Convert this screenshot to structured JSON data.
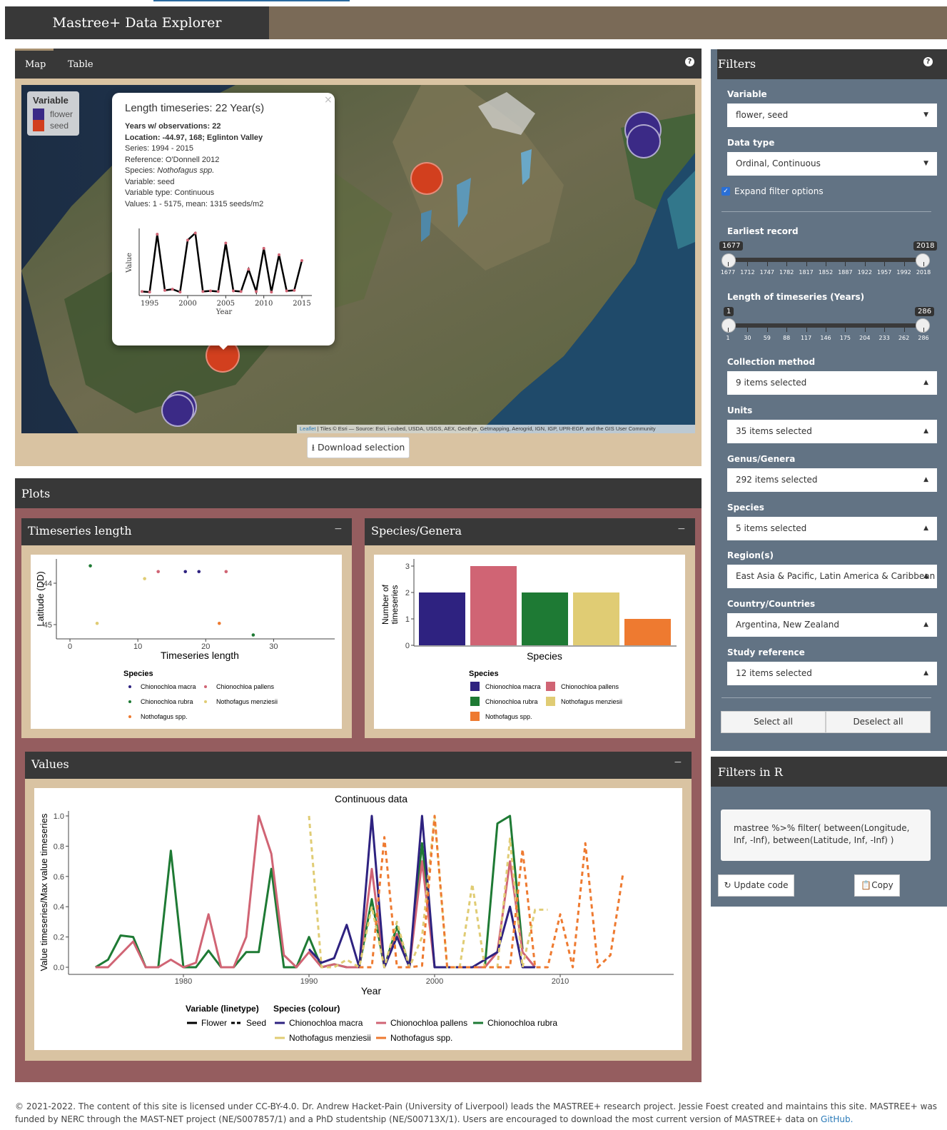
{
  "app": {
    "title": "Mastree+ Data Explorer"
  },
  "tabs": [
    "Map",
    "Table"
  ],
  "map": {
    "legend_title": "Variable",
    "legend_items": [
      {
        "label": "flower",
        "color": "#3b2a86"
      },
      {
        "label": "seed",
        "color": "#d23f1e"
      }
    ],
    "attribution_link": "Leaflet",
    "attribution_text": " | Tiles © Esri — Source: Esri, i-cubed, USDA, USGS, AEX, GeoEye, Getmapping, Aerogrid, IGN, IGP, UPR-EGP, and the GIS User Community",
    "download_label": "Download selection"
  },
  "popup": {
    "title": "Length timeseries: 22 Year(s)",
    "years": "Years w/ observations: 22",
    "location": "Location: -44.97, 168; Eglinton Valley",
    "series": "Series: 1994 - 2015",
    "reference": "Reference: O'Donnell 2012",
    "species_prefix": "Species: ",
    "species_name": "Nothofagus spp.",
    "variable": "Variable: seed",
    "variable_type": "Variable type: Continuous",
    "values": "Values: 1 - 5175, mean: 1315 seeds/m2",
    "close": "×",
    "chart_ylabel": "Value",
    "chart_xlabel": "Year",
    "chart_xticks": [
      "1995",
      "2000",
      "2005",
      "2010",
      "2015"
    ]
  },
  "filters": {
    "title": "Filters",
    "variable_label": "Variable",
    "variable_value": "flower, seed",
    "datatype_label": "Data type",
    "datatype_value": "Ordinal, Continuous",
    "expand_label": "Expand filter options",
    "earliest_label": "Earliest record",
    "earliest_min": "1677",
    "earliest_max": "2018",
    "earliest_ticks": [
      "1677",
      "1712",
      "1747",
      "1782",
      "1817",
      "1852",
      "1887",
      "1922",
      "1957",
      "1992",
      "2018"
    ],
    "length_label": "Length of timeseries (Years)",
    "length_min": "1",
    "length_max": "286",
    "length_ticks": [
      "1",
      "30",
      "59",
      "88",
      "117",
      "146",
      "175",
      "204",
      "233",
      "262",
      "286"
    ],
    "collection_label": "Collection method",
    "collection_value": "9 items selected",
    "units_label": "Units",
    "units_value": "35 items selected",
    "genus_label": "Genus/Genera",
    "genus_value": "292 items selected",
    "species_label": "Species",
    "species_value": "5 items selected",
    "region_label": "Region(s)",
    "region_value": "East Asia & Pacific, Latin America & Caribbean",
    "country_label": "Country/Countries",
    "country_value": "Argentina, New Zealand",
    "study_label": "Study reference",
    "study_value": "12 items selected",
    "select_all": "Select all",
    "deselect_all": "Deselect all"
  },
  "filters_r": {
    "title": "Filters in R",
    "code": "mastree %>% filter( between(Longitude, Inf, -Inf), between(Latitude, Inf, -Inf) )",
    "update_label": "Update code",
    "copy_label": "Copy"
  },
  "plots": {
    "title": "Plots",
    "ts_title": "Timeseries length",
    "sg_title": "Species/Genera",
    "values_title": "Values",
    "collapse": "−"
  },
  "species_colors": {
    "Chionochloa macra": "#2e2280",
    "Chionochloa pallens": "#d06474",
    "Chionochloa rubra": "#1e7a34",
    "Nothofagus menziesii": "#e0cc74",
    "Nothofagus spp.": "#ee7a30"
  },
  "chart_data": [
    {
      "type": "line",
      "title": "Length timeseries: 22 Year(s)",
      "xlabel": "Year",
      "ylabel": "Value",
      "xlim": [
        1994,
        2015
      ],
      "x": [
        1994,
        1995,
        1996,
        1997,
        1998,
        1999,
        2000,
        2001,
        2002,
        2003,
        2004,
        2005,
        2006,
        2007,
        2008,
        2009,
        2010,
        2011,
        2012,
        2013,
        2014,
        2015
      ],
      "series": [
        {
          "values": [
            20,
            10,
            1000,
            40,
            60,
            10,
            900,
            1020,
            20,
            30,
            20,
            850,
            30,
            20,
            400,
            20,
            760,
            10,
            650,
            30,
            40,
            550
          ]
        }
      ]
    },
    {
      "type": "scatter",
      "xlabel": "Timeseries length",
      "ylabel": "Latitude (DD)",
      "xlim": [
        -2,
        39
      ],
      "yticks": [
        -44,
        -45
      ],
      "xticks": [
        0,
        10,
        20,
        30
      ],
      "legend_title": "Species",
      "points": [
        {
          "species": "Chionochloa rubra",
          "x": 3,
          "y": -43.58
        },
        {
          "species": "Nothofagus menziesii",
          "x": 4,
          "y": -44.97
        },
        {
          "species": "Nothofagus menziesii",
          "x": 11,
          "y": -43.89
        },
        {
          "species": "Chionochloa pallens",
          "x": 13,
          "y": -43.72
        },
        {
          "species": "Chionochloa macra",
          "x": 17,
          "y": -43.72
        },
        {
          "species": "Chionochloa macra",
          "x": 19,
          "y": -43.72
        },
        {
          "species": "Nothofagus spp.",
          "x": 22,
          "y": -44.97
        },
        {
          "species": "Chionochloa pallens",
          "x": 23,
          "y": -43.72
        },
        {
          "species": "Chionochloa rubra",
          "x": 27,
          "y": -45.25
        }
      ]
    },
    {
      "type": "bar",
      "xlabel": "Species",
      "ylabel": "Number of timeseries",
      "ylim": [
        0,
        3
      ],
      "yticks": [
        0,
        1,
        2,
        3
      ],
      "legend_title": "Species",
      "categories": [
        "Chionochloa macra",
        "Chionochloa pallens",
        "Chionochloa rubra",
        "Nothofagus menziesii",
        "Nothofagus spp."
      ],
      "values": [
        2,
        3,
        2,
        2,
        1
      ]
    },
    {
      "type": "line",
      "title": "Continuous data",
      "xlabel": "Year",
      "ylabel": "Value timeseries/Max value timeseries",
      "xlim": [
        1972,
        2020
      ],
      "ylim": [
        0,
        1
      ],
      "xticks": [
        1980,
        1990,
        2000,
        2010
      ],
      "yticks": [
        "0.0",
        "0.2",
        "0.4",
        "0.6",
        "0.8",
        "1.0"
      ],
      "legend_linetype_title": "Variable (linetype)",
      "legend_linetypes": [
        "Flower",
        "Seed"
      ],
      "legend_colour_title": "Species (colour)",
      "series": [
        {
          "species": "Chionochloa rubra",
          "linetype": "Flower",
          "x": [
            1973,
            1974,
            1975,
            1976,
            1977,
            1978,
            1979,
            1980,
            1981,
            1982,
            1983,
            1984,
            1985,
            1986,
            1987,
            1988,
            1989,
            1990,
            1991,
            1992,
            1993,
            1994,
            1995,
            1996,
            1997,
            1998,
            1999,
            2000,
            2001,
            2002,
            2003,
            2004,
            2005,
            2006,
            2007
          ],
          "y": [
            0.0,
            0.05,
            0.21,
            0.2,
            0.0,
            0.0,
            0.77,
            0.0,
            0.0,
            0.11,
            0.0,
            0.0,
            0.1,
            0.1,
            0.65,
            0.0,
            0.0,
            0.2,
            0.0,
            0.02,
            0.0,
            0.0,
            0.45,
            0.0,
            0.27,
            0.0,
            0.82,
            0.0,
            0.0,
            0.0,
            0.0,
            0.0,
            0.95,
            1.0,
            0.12
          ]
        },
        {
          "species": "Chionochloa pallens",
          "linetype": "Flower",
          "x": [
            1973,
            1974,
            1976,
            1977,
            1978,
            1979,
            1980,
            1981,
            1982,
            1983,
            1984,
            1985,
            1986,
            1987,
            1988,
            1989,
            1990,
            1991,
            1992,
            1993,
            1994,
            1995,
            1996,
            1997,
            1998,
            1999,
            2000,
            2001,
            2002,
            2003,
            2004,
            2005,
            2006,
            2007,
            2008
          ],
          "y": [
            0.0,
            0.0,
            0.17,
            0.0,
            0.0,
            0.05,
            0.0,
            0.03,
            0.35,
            0.0,
            0.0,
            0.2,
            1.0,
            0.75,
            0.08,
            0.0,
            0.1,
            0.0,
            0.02,
            0.0,
            0.0,
            0.65,
            0.0,
            0.22,
            0.0,
            0.7,
            0.0,
            0.0,
            0.0,
            0.0,
            0.0,
            0.1,
            0.7,
            0.1,
            0.0
          ]
        },
        {
          "species": "Chionochloa macra",
          "linetype": "Flower",
          "x": [
            1990,
            1991,
            1992,
            1993,
            1994,
            1995,
            1996,
            1997,
            1998,
            1999,
            2000,
            2001,
            2002,
            2003,
            2004,
            2005,
            2006,
            2007,
            2008
          ],
          "y": [
            0.12,
            0.03,
            0.06,
            0.28,
            0.0,
            1.0,
            0.0,
            0.2,
            0.0,
            1.0,
            0.0,
            0.0,
            0.0,
            0.0,
            0.05,
            0.1,
            0.4,
            0.0,
            0.0
          ]
        },
        {
          "species": "Nothofagus menziesii",
          "linetype": "Seed",
          "x": [
            1990,
            1991,
            1992,
            1993,
            1994,
            1995,
            1996,
            1997,
            1998,
            1999,
            2000,
            2001,
            2002,
            2003,
            2004,
            2005,
            2006,
            2007,
            2008,
            2009
          ],
          "y": [
            1.0,
            0.0,
            0.0,
            0.05,
            0.0,
            0.4,
            0.0,
            0.3,
            0.0,
            0.2,
            1.0,
            0.0,
            0.0,
            0.55,
            0.0,
            0.0,
            0.85,
            0.0,
            0.38,
            0.38
          ]
        },
        {
          "species": "Nothofagus spp.",
          "linetype": "Seed",
          "x": [
            1994,
            1995,
            1996,
            1997,
            1998,
            1999,
            2000,
            2001,
            2002,
            2003,
            2004,
            2005,
            2006,
            2007,
            2008,
            2009,
            2010,
            2011,
            2012,
            2013,
            2014,
            2015
          ],
          "y": [
            0.0,
            0.0,
            0.86,
            0.0,
            0.0,
            0.01,
            1.0,
            0.0,
            0.0,
            0.0,
            0.0,
            0.0,
            0.0,
            0.78,
            0.0,
            0.0,
            0.35,
            0.0,
            0.82,
            0.0,
            0.08,
            0.62
          ]
        }
      ]
    }
  ],
  "footer": {
    "text": "© 2021-2022. The content of this site is licensed under CC-BY-4.0. Dr. Andrew Hacket-Pain (University of Liverpool) leads the MASTREE+ research project. Jessie Foest created and maintains this site. MASTREE+ was funded by NERC through the MAST-NET project (NE/S007857/1) and a PhD studentship (NE/S00713X/1). Users are encouraged to download the most current version of MASTREE+ data on ",
    "link": "GitHub."
  }
}
